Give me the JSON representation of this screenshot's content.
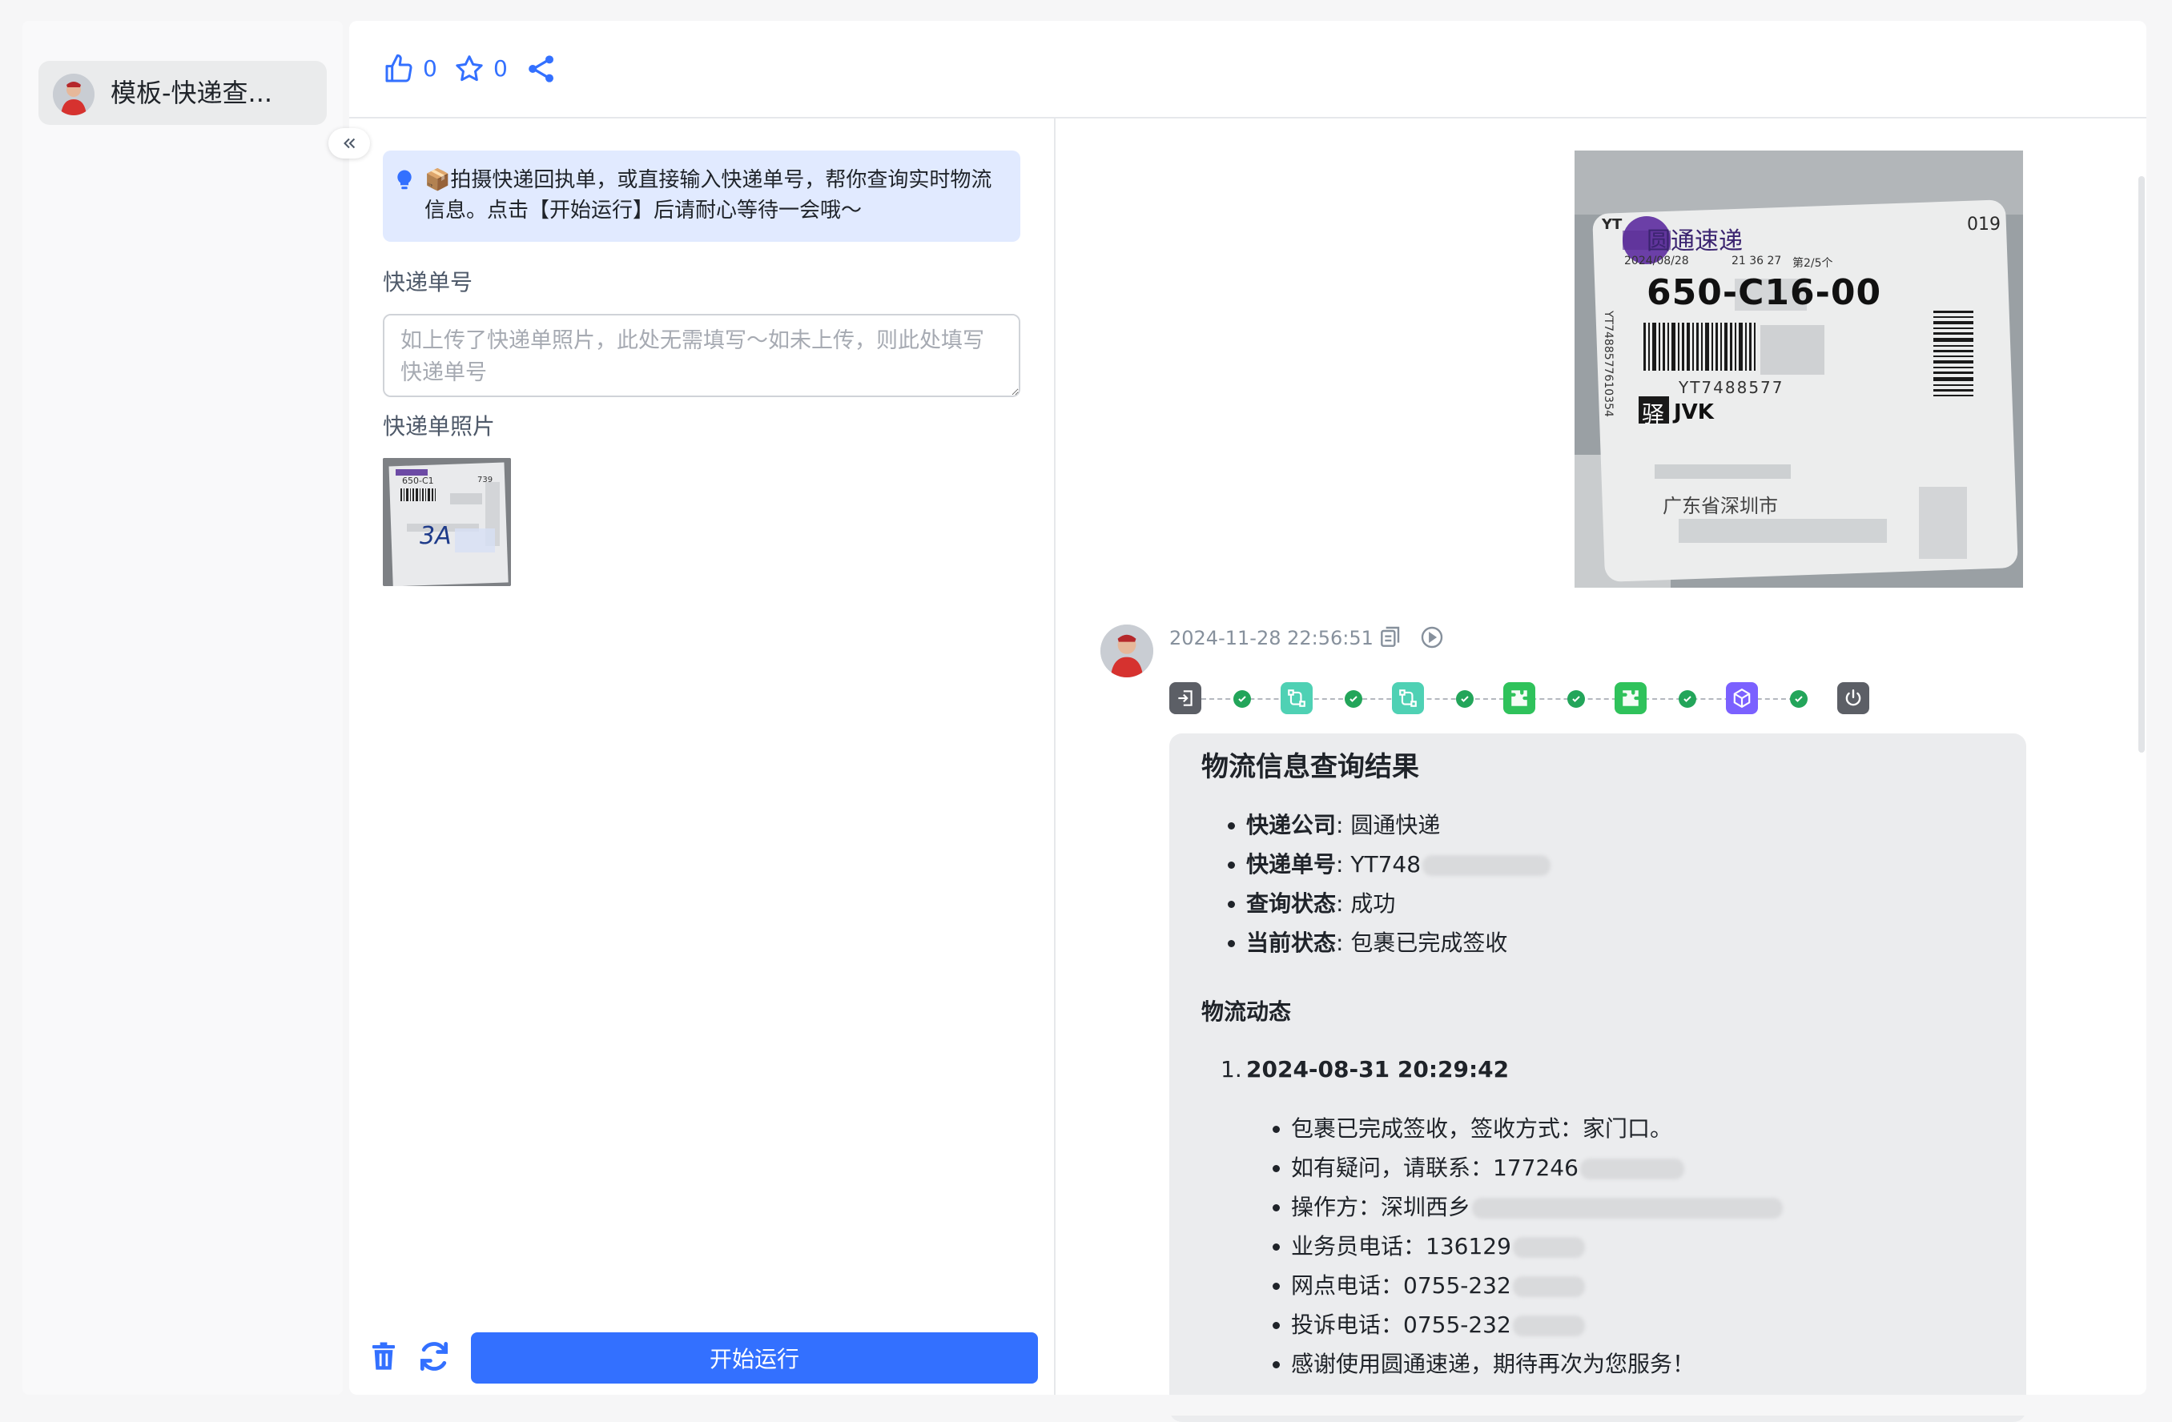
{
  "sidebar": {
    "item_title": "模板-快递查..."
  },
  "toolbar": {
    "like_count": "0",
    "star_count": "0"
  },
  "form": {
    "tip": "📦拍摄快递回执单，或直接输入快递单号，帮你查询实时物流信息。点击【开始运行】后请耐心等待一会哦～",
    "tracking_label": "快递单号",
    "tracking_placeholder": "如上传了快递单照片，此处无需填写～如未上传，则此处填写快递单号",
    "tracking_value": "",
    "photo_label": "快递单照片",
    "run_button": "开始运行"
  },
  "thumbnail": {
    "text_top": "650-C1",
    "text_num": "739",
    "handwriting": "3A"
  },
  "photo": {
    "brand": "圆通速递",
    "brand_prefix": "YT",
    "code": "650-C16-00",
    "small_num": "019",
    "small_date": "2024/08/28",
    "small_time": "21 36 27",
    "small_page": "第2/5个",
    "barcode_text": "YT7488577",
    "station_tag": "驿",
    "station_code": "JVK",
    "address": "广东省深圳市",
    "side_text": "YT7488577610354"
  },
  "chat": {
    "timestamp": "2024-11-28 22:56:51",
    "result": {
      "title": "物流信息查询结果",
      "summary": [
        {
          "key": "快递公司",
          "value": "圆通快递"
        },
        {
          "key": "快递单号",
          "value": "YT748"
        },
        {
          "key": "查询状态",
          "value": "成功"
        },
        {
          "key": "当前状态",
          "value": "包裹已完成签收"
        }
      ],
      "dynamics_title": "物流动态",
      "event_index": "1.",
      "event_time": "2024-08-31 20:29:42",
      "event_lines": [
        "包裹已完成签收，签收方式：家门口。",
        "如有疑问，请联系：177246",
        "操作方：深圳西乡",
        "业务员电话：136129",
        "网点电话：0755-232",
        "投诉电话：0755-232",
        "感谢使用圆通速递，期待再次为您服务！"
      ]
    }
  },
  "colors": {
    "accent": "#3370ff",
    "tip_bg": "#e1eaff",
    "success": "#23a55a",
    "node_teal": "#4fd1b4",
    "node_green": "#2fc25b",
    "node_purple": "#7b61ff",
    "node_dark": "#5c5f66",
    "delete_icon": "#3370ff"
  },
  "icons": {
    "like": "thumb-up-icon",
    "star": "star-icon",
    "share": "share-icon",
    "collapse": "double-chevron-left-icon",
    "tip": "lightbulb-icon",
    "delete": "trash-icon",
    "refresh": "refresh-icon",
    "copy": "copy-icon",
    "play": "play-circle-icon"
  }
}
